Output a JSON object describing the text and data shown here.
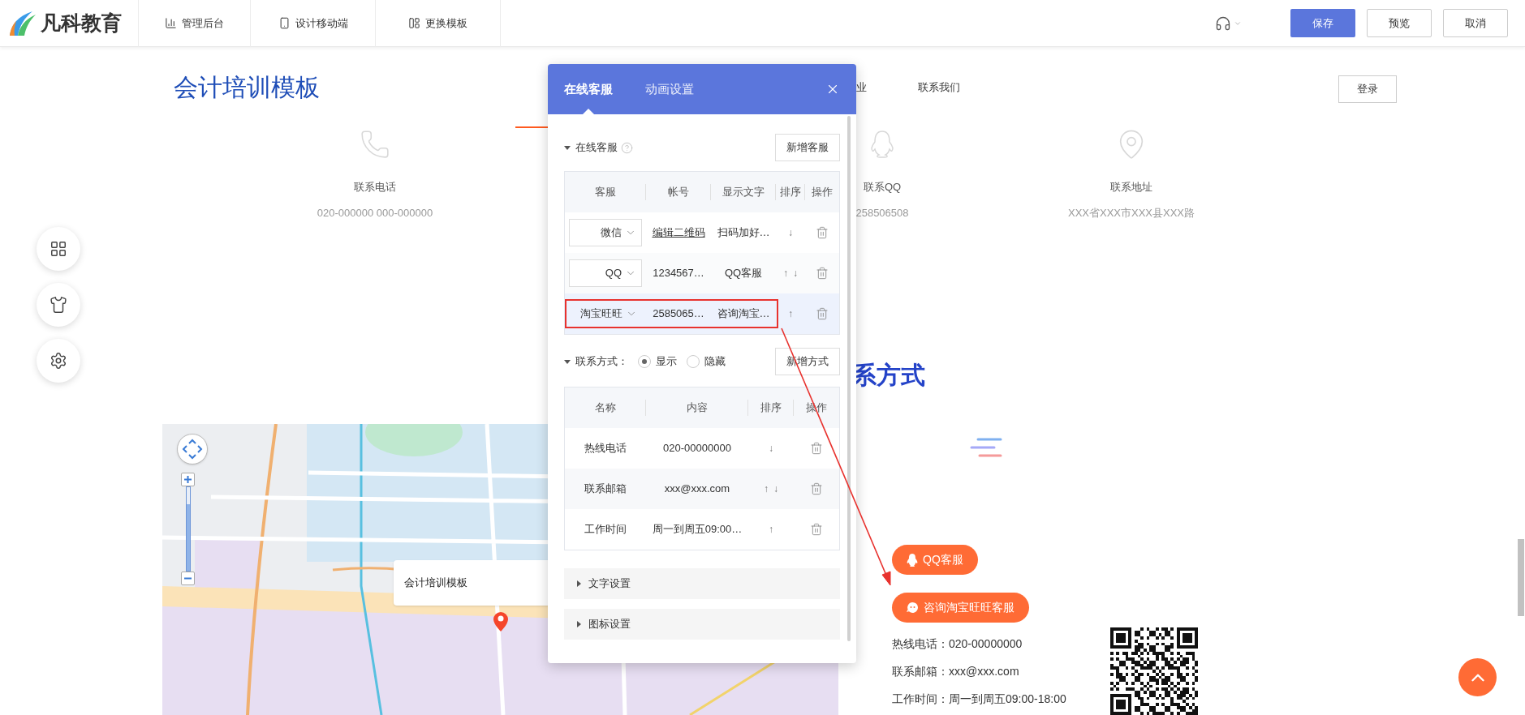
{
  "topbar": {
    "logo_text": "凡科教育",
    "nav": [
      {
        "kind": "chart",
        "label": "管理后台"
      },
      {
        "kind": "phone",
        "label": "设计移动端"
      },
      {
        "kind": "template",
        "label": "更换模板"
      }
    ],
    "buttons": [
      {
        "label": "保存",
        "kind": "primary"
      },
      {
        "label": "预览",
        "kind": "default"
      },
      {
        "label": "取消",
        "kind": "default"
      }
    ]
  },
  "site": {
    "title": "会计培训模板",
    "nav": [
      {
        "label": "业"
      },
      {
        "label": "联系我们"
      }
    ],
    "login": "登录",
    "contacts": [
      {
        "kind": "phone",
        "label": "联系电话",
        "value": "020-000000 000-000000"
      },
      {
        "kind": "qq",
        "label": "联系QQ",
        "value": "258506508"
      },
      {
        "kind": "address",
        "label": "联系地址",
        "value": "XXX省XXX市XXX县XXX路"
      }
    ],
    "section_heading": "系方式",
    "map": {
      "bubble": "会计培训模板",
      "zoom": {
        "level": 0.8
      }
    },
    "service_buttons": [
      {
        "kind": "qq",
        "label": "QQ客服"
      },
      {
        "kind": "wangwang",
        "label": "咨询淘宝旺旺客服"
      }
    ],
    "contact_lines": [
      "热线电话：020-00000000",
      "联系邮箱：xxx@xxx.com",
      "工作时间：周一到周五09:00-18:00"
    ]
  },
  "side_tools": [
    {
      "kind": "grid"
    },
    {
      "kind": "shirt"
    },
    {
      "kind": "gear"
    }
  ],
  "dialog": {
    "tabs": [
      {
        "label": "在线客服",
        "selected": true
      },
      {
        "label": "动画设置",
        "selected": false
      }
    ],
    "service_section": {
      "title": "在线客服",
      "expanded": true,
      "add_button": "新增客服",
      "columns": [
        "客服",
        "帐号",
        "显示文字",
        "排序",
        "操作"
      ],
      "rows": [
        {
          "type": "微信",
          "account": {
            "text": "编辑二维码",
            "kind": "link"
          },
          "display": "扫码加好…",
          "sort": [
            "↓"
          ],
          "highlighted": false
        },
        {
          "type": "QQ",
          "account": {
            "text": "1234567…",
            "kind": "text"
          },
          "display": "QQ客服",
          "sort": [
            "↑",
            "↓"
          ],
          "highlighted": false
        },
        {
          "type": "淘宝旺旺",
          "account": {
            "text": "2585065…",
            "kind": "text"
          },
          "display": "咨询淘宝…",
          "sort": [
            "↑"
          ],
          "highlighted": true
        }
      ]
    },
    "contact_section": {
      "title": "联系方式：",
      "expanded": true,
      "radios": [
        {
          "label": "显示",
          "selected": true
        },
        {
          "label": "隐藏",
          "selected": false
        }
      ],
      "add_button": "新增方式",
      "columns": [
        "名称",
        "内容",
        "排序",
        "操作"
      ],
      "rows": [
        {
          "name": "热线电话",
          "content": "020-00000000",
          "sort": [
            "↓"
          ]
        },
        {
          "name": "联系邮箱",
          "content": "xxx@xxx.com",
          "sort": [
            "↑",
            "↓"
          ]
        },
        {
          "name": "工作时间",
          "content": "周一到周五09:00…",
          "sort": [
            "↑"
          ]
        }
      ]
    },
    "collapsed_sections": [
      {
        "title": "文字设置",
        "expanded": false
      },
      {
        "title": "图标设置",
        "expanded": false
      }
    ]
  }
}
